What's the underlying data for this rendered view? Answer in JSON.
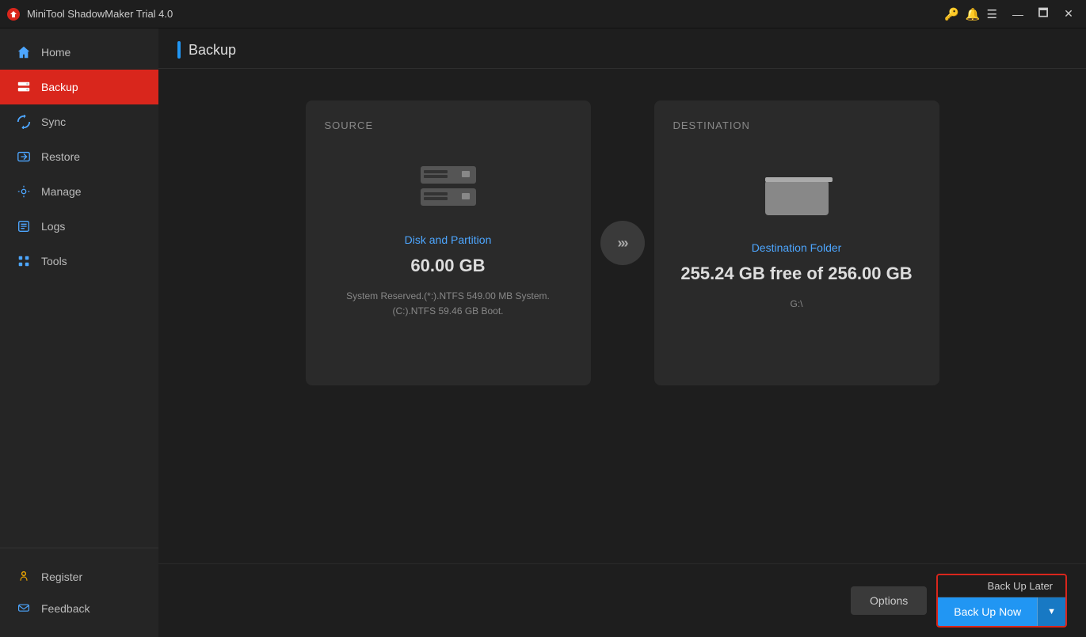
{
  "titleBar": {
    "appName": "MiniTool ShadowMaker Trial 4.0",
    "icons": {
      "key": "🔑",
      "bell": "🔔",
      "menu": "☰",
      "minimize": "—",
      "maximize": "🗖",
      "close": "✕"
    }
  },
  "sidebar": {
    "items": [
      {
        "id": "home",
        "label": "Home",
        "active": false
      },
      {
        "id": "backup",
        "label": "Backup",
        "active": true
      },
      {
        "id": "sync",
        "label": "Sync",
        "active": false
      },
      {
        "id": "restore",
        "label": "Restore",
        "active": false
      },
      {
        "id": "manage",
        "label": "Manage",
        "active": false
      },
      {
        "id": "logs",
        "label": "Logs",
        "active": false
      },
      {
        "id": "tools",
        "label": "Tools",
        "active": false
      }
    ],
    "bottomItems": [
      {
        "id": "register",
        "label": "Register"
      },
      {
        "id": "feedback",
        "label": "Feedback"
      }
    ]
  },
  "content": {
    "pageTitle": "Backup",
    "source": {
      "label": "SOURCE",
      "subtitle": "Disk and Partition",
      "size": "60.00 GB",
      "detail": "System Reserved.(*:).NTFS 549.00 MB System.\n(C:).NTFS 59.46 GB Boot."
    },
    "destination": {
      "label": "DESTINATION",
      "subtitle": "Destination Folder",
      "freeSpace": "255.24 GB free of 256.00 GB",
      "path": "G:\\"
    },
    "footer": {
      "optionsLabel": "Options",
      "backUpLaterLabel": "Back Up Later",
      "backUpNowLabel": "Back Up Now"
    }
  }
}
